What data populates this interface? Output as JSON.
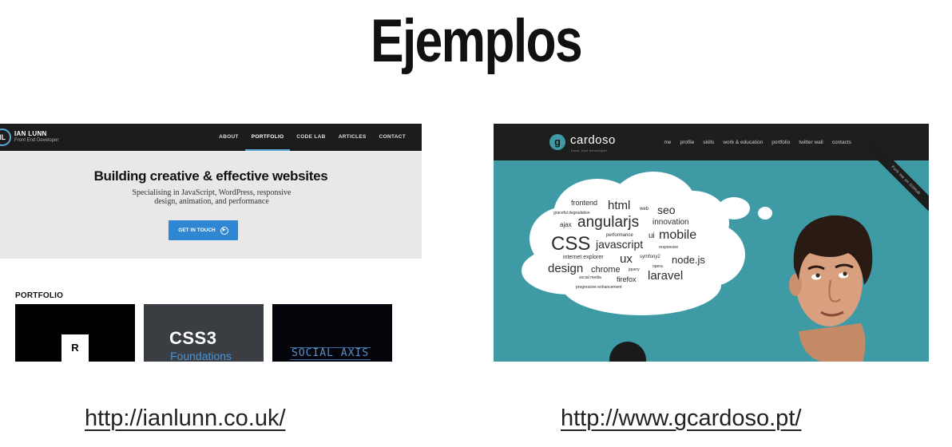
{
  "slide": {
    "title": "Ejemplos"
  },
  "left_example": {
    "url": "http://ianlunn.co.uk/",
    "logo_text": "IL",
    "site_name": "IAN LUNN",
    "site_role": "Front End Developer",
    "nav": [
      "ABOUT",
      "PORTFOLIO",
      "CODE LAB",
      "ARTICLES",
      "CONTACT"
    ],
    "active_nav": "PORTFOLIO",
    "headline": "Building creative & effective websites",
    "subheadline": "Specialising in JavaScript, WordPress, responsive design, animation, and performance",
    "cta_label": "GET IN TOUCH",
    "cta_icon": "arrow-circle-icon",
    "portfolio_heading": "PORTFOLIO",
    "tiles": [
      "R",
      "CSS3",
      "Foundations",
      "SOCIAL AXIS"
    ],
    "colors": {
      "nav": "#1c1c1c",
      "accent": "#2f86d3",
      "hero": "#e8e8e8"
    }
  },
  "right_example": {
    "url": "http://www.gcardoso.pt/",
    "logo_text": "g",
    "site_name": "cardoso",
    "tagline": "front end developer",
    "nav": [
      "me",
      "profile",
      "skills",
      "work & education",
      "portfolio",
      "twitter wall",
      "contacts"
    ],
    "ribbon": "Fork me on GitHub",
    "word_cloud": [
      "frontend",
      "html",
      "web",
      "seo",
      "graceful degradation",
      "ajax",
      "angularjs",
      "innovation",
      "performance",
      "ui",
      "mobile",
      "CSS",
      "javascript",
      "responsive",
      "internet explorer",
      "symfony2",
      "ux",
      "node.js",
      "design",
      "chrome",
      "jquery",
      "opera",
      "laravel",
      "social media",
      "firefox",
      "progressive enhancement"
    ],
    "colors": {
      "nav": "#1e1e1e",
      "background": "#3e9aa5",
      "cloud": "#ffffff"
    }
  }
}
